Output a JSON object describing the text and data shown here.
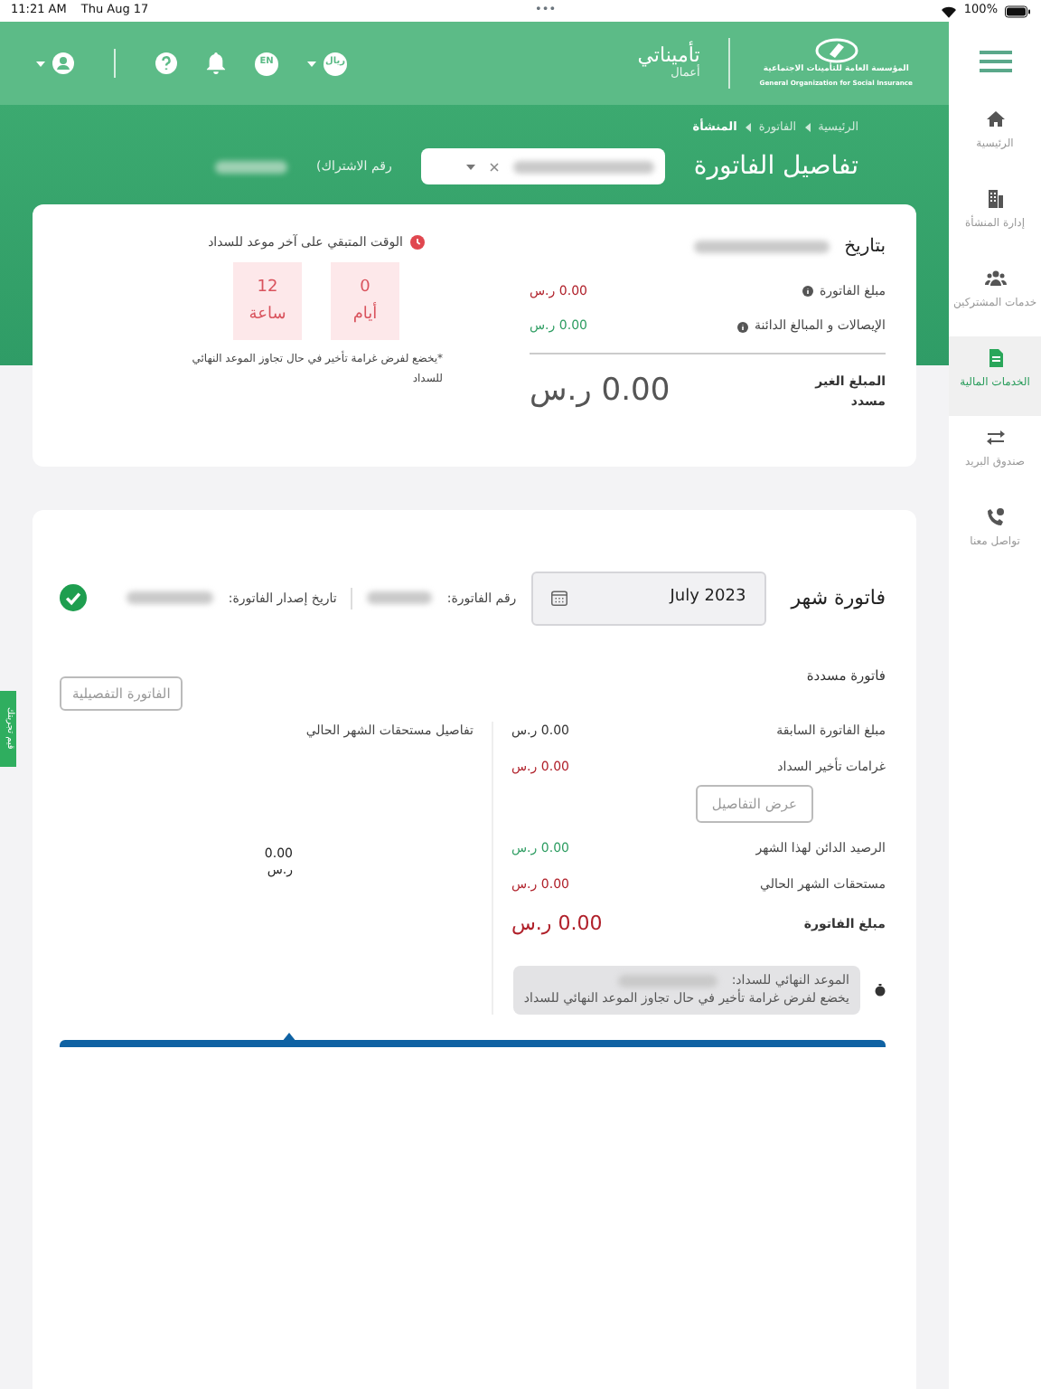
{
  "status_bar": {
    "time": "11:21 AM",
    "date": "Thu Aug 17",
    "dots": "•••",
    "battery": "100%"
  },
  "header": {
    "org_ar": "المؤسسة العامة للتأمينات الاجتماعية",
    "org_en": "General Organization for Social Insurance",
    "brand": "تأميناتي",
    "brand_sub": "أعمال",
    "currency": "ريال",
    "language": "EN"
  },
  "sidebar": {
    "items": [
      {
        "label": "الرئيسية",
        "kind": "home",
        "selected": false
      },
      {
        "label": "إدارة المنشأة",
        "kind": "building",
        "selected": false
      },
      {
        "label": "خدمات المشتركين",
        "kind": "users",
        "selected": false
      },
      {
        "label": "الخدمات المالية",
        "kind": "document",
        "selected": true
      },
      {
        "label": "صندوق البريد",
        "kind": "transfer",
        "selected": false
      },
      {
        "label": "تواصل معنا",
        "kind": "phone",
        "selected": false
      }
    ]
  },
  "breadcrumb": [
    "الرئيسية",
    "الفاتورة",
    "المنشأة"
  ],
  "page_title": "تفاصيل الفاتورة",
  "subscription": {
    "label": "(رقم الاشتراك"
  },
  "summary": {
    "heading": "بتاريخ",
    "rows": [
      {
        "label": "مبلغ الفاتورة",
        "info": true,
        "amount": "0.00 ر.س",
        "color": "#b0202a"
      },
      {
        "label": "الإيصالات و المبالغ الدائنة",
        "info": true,
        "amount": "0.00 ر.س",
        "color": "#2e9d62"
      }
    ],
    "unpaid_label": "المبلغ الغير مسدد",
    "unpaid_amount": "0.00 ر.س",
    "countdown": {
      "title": "الوقت المتبقي على آخر موعد للسداد",
      "units": [
        {
          "value": "0",
          "unit": "أيام"
        },
        {
          "value": "12",
          "unit": "ساعة"
        }
      ],
      "note": "*يخضع لفرض غرامة تأخير في حال تجاوز الموعد النهائي للسداد"
    }
  },
  "invoice": {
    "title": "فاتورة شهر",
    "month": "July 2023",
    "number_label": "رقم الفاتورة:",
    "issue_label": "تاريخ إصدار الفاتورة:",
    "paid": true,
    "status": "فاتورة مسددة",
    "detail_button": "الفاتورة التفصيلية",
    "rows": [
      {
        "label": "مبلغ الفاتورة السابقة",
        "amount": "0.00 ر.س",
        "color": "#333333"
      },
      {
        "label": "غرامات تأخير السداد",
        "amount": "0.00 ر.س",
        "color": "#b0202a",
        "button": "عرض التفاصيل"
      },
      {
        "label": "الرصيد الدائن لهذا الشهر",
        "amount": "0.00 ر.س",
        "color": "#2e9d62"
      },
      {
        "label": "مستحقات الشهر الحالي",
        "amount": "0.00 ر.س",
        "color": "#b0202a"
      }
    ],
    "total_label": "مبلغ الفاتورة",
    "total_amount": "0.00 ر.س",
    "breakdown_title": "تفاصيل مستحقات الشهر الحالي",
    "breakdown_value": "0.00",
    "breakdown_unit": "ر.س",
    "deadline_label": "الموعد النهائي للسداد:",
    "deadline_note": "يخضع لفرض غرامة تأخير في حال تجاوز الموعد النهائي للسداد"
  },
  "feedback_tab": "قيم تجربتك"
}
